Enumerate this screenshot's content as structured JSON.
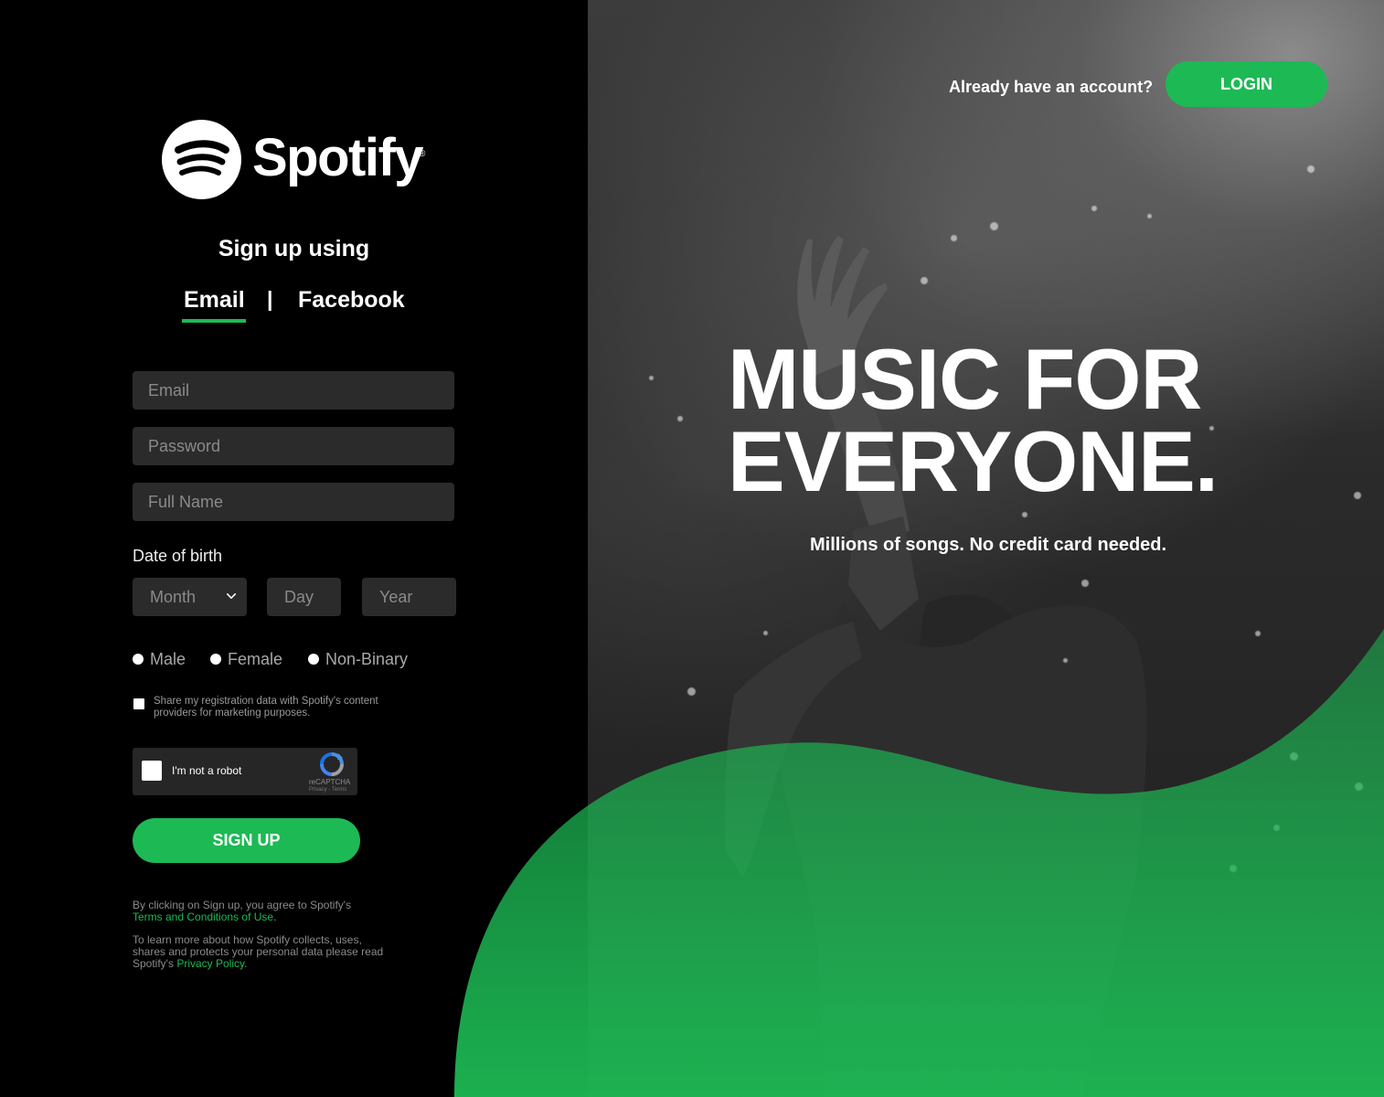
{
  "brand": {
    "name": "Spotify",
    "registered": "®",
    "accent_color": "#1db954"
  },
  "signup": {
    "title": "Sign up using",
    "tabs": {
      "email": "Email",
      "separator": "|",
      "facebook": "Facebook"
    },
    "fields": {
      "email_placeholder": "Email",
      "password_placeholder": "Password",
      "fullname_placeholder": "Full Name"
    },
    "dob": {
      "label": "Date of birth",
      "month": "Month",
      "day": "Day",
      "year": "Year"
    },
    "gender": {
      "male": "Male",
      "female": "Female",
      "nonbinary": "Non-Binary"
    },
    "share_text": "Share my registration data with Spotify's content providers for marketing purposes.",
    "captcha": {
      "label": "I'm not a robot",
      "brand": "reCAPTCHA",
      "links": "Privacy - Terms"
    },
    "button": "SIGN UP",
    "legal": {
      "line1": "By clicking on Sign up, you agree to Spotify's",
      "terms_link": "Terms and Conditions of Use",
      "line1_end": ".",
      "line2": "To learn more about how Spotify collects, uses, shares and protects your personal data please read Spotify's",
      "privacy_link": "Privacy Policy",
      "line2_end": "."
    }
  },
  "header": {
    "already": "Already have an account?",
    "login": "LOGIN"
  },
  "hero": {
    "headline_1": "MUSIC FOR",
    "headline_2": "EVERYONE.",
    "subline": "Millions of songs. No credit card needed."
  },
  "icons": {
    "logo": "spotify-logo-icon",
    "chevron": "chevron-down-icon",
    "recaptcha": "recaptcha-icon"
  }
}
